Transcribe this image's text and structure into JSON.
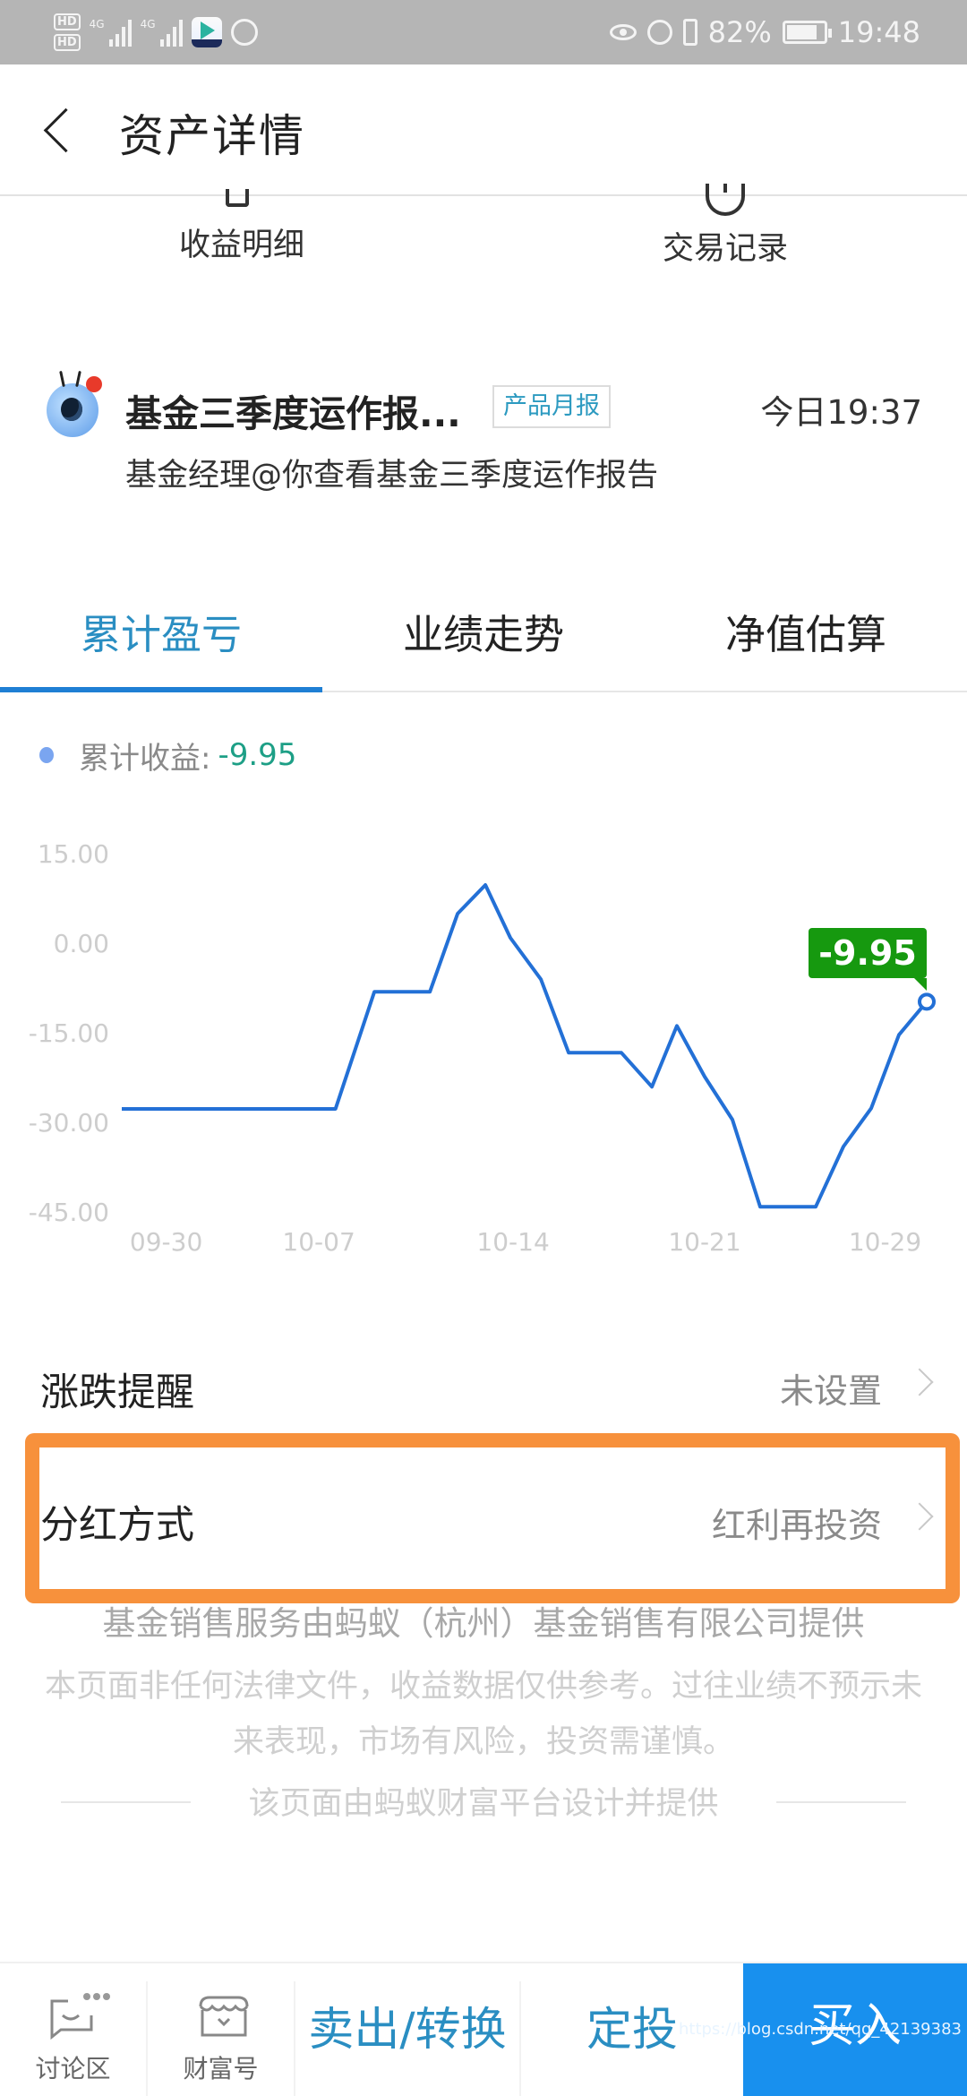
{
  "status_bar": {
    "sim1": "HD",
    "sim2": "HD",
    "network1": "4G",
    "network2": "4G",
    "battery": "82%",
    "battery_level": 0.82,
    "time": "19:48"
  },
  "header": {
    "title": "资产详情"
  },
  "quick_actions": [
    {
      "label": "收益明细",
      "icon": "receipt-icon"
    },
    {
      "label": "交易记录",
      "icon": "clock-icon"
    }
  ],
  "news": {
    "title": "基金三季度运作报...",
    "tag": "产品月报",
    "time": "今日19:37",
    "subtitle": "基金经理@你查看基金三季度运作报告",
    "has_unread": true
  },
  "tabs": [
    {
      "label": "累计盈亏",
      "active": true
    },
    {
      "label": "业绩走势",
      "active": false
    },
    {
      "label": "净值估算",
      "active": false
    }
  ],
  "legend": {
    "label": "累计收益:",
    "value": "-9.95"
  },
  "chart_data": {
    "type": "line",
    "title": "",
    "xlabel": "",
    "ylabel": "",
    "ylim": [
      -45,
      15
    ],
    "y_ticks": [
      "15.00",
      "0.00",
      "-15.00",
      "-30.00",
      "-45.00"
    ],
    "y_tick_values": [
      15,
      0,
      -15,
      -30,
      -45
    ],
    "x_range": [
      0,
      29
    ],
    "x_tick_labels": [
      "09-30",
      "10-07",
      "10-14",
      "10-21",
      "10-29"
    ],
    "x_tick_positions": [
      1.6,
      7.1,
      14.1,
      21,
      27.5
    ],
    "grid": false,
    "series": [
      {
        "name": "累计收益",
        "color": "#2370d6",
        "x": [
          0,
          7.7,
          9.1,
          11.1,
          12.1,
          13.1,
          14,
          15.1,
          16.1,
          18,
          19.1,
          20,
          21,
          22,
          23,
          25,
          26,
          27,
          28,
          29
        ],
        "values": [
          -27.9,
          -27.9,
          -8.3,
          -8.3,
          4.8,
          9.6,
          0.75,
          -6.2,
          -18.5,
          -18.5,
          -24.2,
          -14,
          -22.5,
          -29.7,
          -44.3,
          -44.3,
          -34.2,
          -27.8,
          -15.5,
          -9.95
        ]
      }
    ],
    "highlight": {
      "value": "-9.95",
      "color": "#16990f"
    }
  },
  "settings": [
    {
      "label": "涨跌提醒",
      "value": "未设置"
    },
    {
      "label": "分红方式",
      "value": "红利再投资",
      "highlighted": true
    }
  ],
  "footer": {
    "provider": "基金销售服务由蚂蚁（杭州）基金销售有限公司提供",
    "disclaimer": "本页面非任何法律文件，收益数据仅供参考。过往业绩不预示未来表现，市场有风险，投资需谨慎。",
    "designed_by": "该页面由蚂蚁财富平台设计并提供"
  },
  "bottom_bar": {
    "discuss": "讨论区",
    "wealth": "财富号",
    "sell": "卖出/转换",
    "auto_invest": "定投",
    "buy": "买入",
    "watermark": "https://blog.csdn.net/qq_42139383"
  }
}
